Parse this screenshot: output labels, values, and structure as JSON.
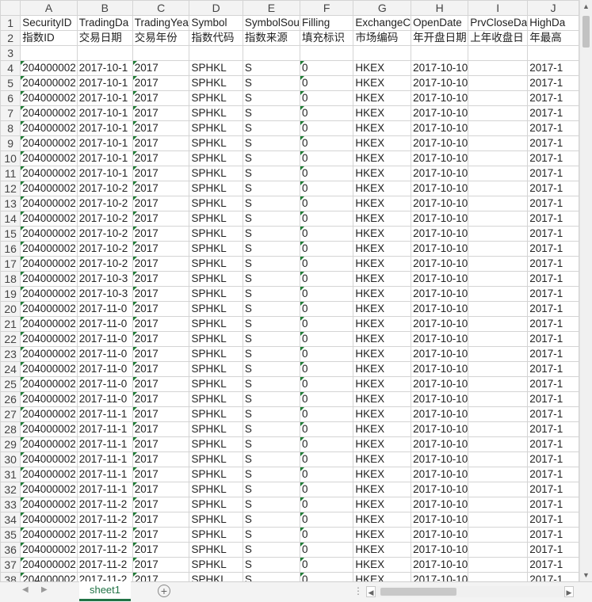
{
  "columns": [
    "A",
    "B",
    "C",
    "D",
    "E",
    "F",
    "G",
    "H",
    "I",
    "J"
  ],
  "header_row_en": [
    "SecurityID",
    "TradingDa",
    "TradingYea",
    "Symbol",
    "SymbolSou",
    "Filling",
    "ExchangeC",
    "OpenDate",
    "PrvCloseDa",
    "HighDa"
  ],
  "header_row_cn": [
    "指数ID",
    "交易日期",
    "交易年份",
    "指数代码",
    "指数来源",
    "填充标识",
    "市场编码",
    "年开盘日期",
    "上年收盘日",
    "年最高"
  ],
  "data_rows": [
    {
      "n": "4",
      "a": "204000002",
      "b": "2017-10-1",
      "c": "2017",
      "d": "SPHKL",
      "e": "S",
      "f": "0",
      "g": "HKEX",
      "h": "2017-10-10",
      "j": "2017-1"
    },
    {
      "n": "5",
      "a": "204000002",
      "b": "2017-10-1",
      "c": "2017",
      "d": "SPHKL",
      "e": "S",
      "f": "0",
      "g": "HKEX",
      "h": "2017-10-10",
      "j": "2017-1"
    },
    {
      "n": "6",
      "a": "204000002",
      "b": "2017-10-1",
      "c": "2017",
      "d": "SPHKL",
      "e": "S",
      "f": "0",
      "g": "HKEX",
      "h": "2017-10-10",
      "j": "2017-1"
    },
    {
      "n": "7",
      "a": "204000002",
      "b": "2017-10-1",
      "c": "2017",
      "d": "SPHKL",
      "e": "S",
      "f": "0",
      "g": "HKEX",
      "h": "2017-10-10",
      "j": "2017-1"
    },
    {
      "n": "8",
      "a": "204000002",
      "b": "2017-10-1",
      "c": "2017",
      "d": "SPHKL",
      "e": "S",
      "f": "0",
      "g": "HKEX",
      "h": "2017-10-10",
      "j": "2017-1"
    },
    {
      "n": "9",
      "a": "204000002",
      "b": "2017-10-1",
      "c": "2017",
      "d": "SPHKL",
      "e": "S",
      "f": "0",
      "g": "HKEX",
      "h": "2017-10-10",
      "j": "2017-1"
    },
    {
      "n": "10",
      "a": "204000002",
      "b": "2017-10-1",
      "c": "2017",
      "d": "SPHKL",
      "e": "S",
      "f": "0",
      "g": "HKEX",
      "h": "2017-10-10",
      "j": "2017-1"
    },
    {
      "n": "11",
      "a": "204000002",
      "b": "2017-10-1",
      "c": "2017",
      "d": "SPHKL",
      "e": "S",
      "f": "0",
      "g": "HKEX",
      "h": "2017-10-10",
      "j": "2017-1"
    },
    {
      "n": "12",
      "a": "204000002",
      "b": "2017-10-2",
      "c": "2017",
      "d": "SPHKL",
      "e": "S",
      "f": "0",
      "g": "HKEX",
      "h": "2017-10-10",
      "j": "2017-1"
    },
    {
      "n": "13",
      "a": "204000002",
      "b": "2017-10-2",
      "c": "2017",
      "d": "SPHKL",
      "e": "S",
      "f": "0",
      "g": "HKEX",
      "h": "2017-10-10",
      "j": "2017-1"
    },
    {
      "n": "14",
      "a": "204000002",
      "b": "2017-10-2",
      "c": "2017",
      "d": "SPHKL",
      "e": "S",
      "f": "0",
      "g": "HKEX",
      "h": "2017-10-10",
      "j": "2017-1"
    },
    {
      "n": "15",
      "a": "204000002",
      "b": "2017-10-2",
      "c": "2017",
      "d": "SPHKL",
      "e": "S",
      "f": "0",
      "g": "HKEX",
      "h": "2017-10-10",
      "j": "2017-1"
    },
    {
      "n": "16",
      "a": "204000002",
      "b": "2017-10-2",
      "c": "2017",
      "d": "SPHKL",
      "e": "S",
      "f": "0",
      "g": "HKEX",
      "h": "2017-10-10",
      "j": "2017-1"
    },
    {
      "n": "17",
      "a": "204000002",
      "b": "2017-10-2",
      "c": "2017",
      "d": "SPHKL",
      "e": "S",
      "f": "0",
      "g": "HKEX",
      "h": "2017-10-10",
      "j": "2017-1"
    },
    {
      "n": "18",
      "a": "204000002",
      "b": "2017-10-3",
      "c": "2017",
      "d": "SPHKL",
      "e": "S",
      "f": "0",
      "g": "HKEX",
      "h": "2017-10-10",
      "j": "2017-1"
    },
    {
      "n": "19",
      "a": "204000002",
      "b": "2017-10-3",
      "c": "2017",
      "d": "SPHKL",
      "e": "S",
      "f": "0",
      "g": "HKEX",
      "h": "2017-10-10",
      "j": "2017-1"
    },
    {
      "n": "20",
      "a": "204000002",
      "b": "2017-11-0",
      "c": "2017",
      "d": "SPHKL",
      "e": "S",
      "f": "0",
      "g": "HKEX",
      "h": "2017-10-10",
      "j": "2017-1"
    },
    {
      "n": "21",
      "a": "204000002",
      "b": "2017-11-0",
      "c": "2017",
      "d": "SPHKL",
      "e": "S",
      "f": "0",
      "g": "HKEX",
      "h": "2017-10-10",
      "j": "2017-1"
    },
    {
      "n": "22",
      "a": "204000002",
      "b": "2017-11-0",
      "c": "2017",
      "d": "SPHKL",
      "e": "S",
      "f": "0",
      "g": "HKEX",
      "h": "2017-10-10",
      "j": "2017-1"
    },
    {
      "n": "23",
      "a": "204000002",
      "b": "2017-11-0",
      "c": "2017",
      "d": "SPHKL",
      "e": "S",
      "f": "0",
      "g": "HKEX",
      "h": "2017-10-10",
      "j": "2017-1"
    },
    {
      "n": "24",
      "a": "204000002",
      "b": "2017-11-0",
      "c": "2017",
      "d": "SPHKL",
      "e": "S",
      "f": "0",
      "g": "HKEX",
      "h": "2017-10-10",
      "j": "2017-1"
    },
    {
      "n": "25",
      "a": "204000002",
      "b": "2017-11-0",
      "c": "2017",
      "d": "SPHKL",
      "e": "S",
      "f": "0",
      "g": "HKEX",
      "h": "2017-10-10",
      "j": "2017-1"
    },
    {
      "n": "26",
      "a": "204000002",
      "b": "2017-11-0",
      "c": "2017",
      "d": "SPHKL",
      "e": "S",
      "f": "0",
      "g": "HKEX",
      "h": "2017-10-10",
      "j": "2017-1"
    },
    {
      "n": "27",
      "a": "204000002",
      "b": "2017-11-1",
      "c": "2017",
      "d": "SPHKL",
      "e": "S",
      "f": "0",
      "g": "HKEX",
      "h": "2017-10-10",
      "j": "2017-1"
    },
    {
      "n": "28",
      "a": "204000002",
      "b": "2017-11-1",
      "c": "2017",
      "d": "SPHKL",
      "e": "S",
      "f": "0",
      "g": "HKEX",
      "h": "2017-10-10",
      "j": "2017-1"
    },
    {
      "n": "29",
      "a": "204000002",
      "b": "2017-11-1",
      "c": "2017",
      "d": "SPHKL",
      "e": "S",
      "f": "0",
      "g": "HKEX",
      "h": "2017-10-10",
      "j": "2017-1"
    },
    {
      "n": "30",
      "a": "204000002",
      "b": "2017-11-1",
      "c": "2017",
      "d": "SPHKL",
      "e": "S",
      "f": "0",
      "g": "HKEX",
      "h": "2017-10-10",
      "j": "2017-1"
    },
    {
      "n": "31",
      "a": "204000002",
      "b": "2017-11-1",
      "c": "2017",
      "d": "SPHKL",
      "e": "S",
      "f": "0",
      "g": "HKEX",
      "h": "2017-10-10",
      "j": "2017-1"
    },
    {
      "n": "32",
      "a": "204000002",
      "b": "2017-11-1",
      "c": "2017",
      "d": "SPHKL",
      "e": "S",
      "f": "0",
      "g": "HKEX",
      "h": "2017-10-10",
      "j": "2017-1"
    },
    {
      "n": "33",
      "a": "204000002",
      "b": "2017-11-2",
      "c": "2017",
      "d": "SPHKL",
      "e": "S",
      "f": "0",
      "g": "HKEX",
      "h": "2017-10-10",
      "j": "2017-1"
    },
    {
      "n": "34",
      "a": "204000002",
      "b": "2017-11-2",
      "c": "2017",
      "d": "SPHKL",
      "e": "S",
      "f": "0",
      "g": "HKEX",
      "h": "2017-10-10",
      "j": "2017-1"
    },
    {
      "n": "35",
      "a": "204000002",
      "b": "2017-11-2",
      "c": "2017",
      "d": "SPHKL",
      "e": "S",
      "f": "0",
      "g": "HKEX",
      "h": "2017-10-10",
      "j": "2017-1"
    },
    {
      "n": "36",
      "a": "204000002",
      "b": "2017-11-2",
      "c": "2017",
      "d": "SPHKL",
      "e": "S",
      "f": "0",
      "g": "HKEX",
      "h": "2017-10-10",
      "j": "2017-1"
    },
    {
      "n": "37",
      "a": "204000002",
      "b": "2017-11-2",
      "c": "2017",
      "d": "SPHKL",
      "e": "S",
      "f": "0",
      "g": "HKEX",
      "h": "2017-10-10",
      "j": "2017-1"
    },
    {
      "n": "38",
      "a": "204000002",
      "b": "2017-11-2",
      "c": "2017",
      "d": "SPHKL",
      "e": "S",
      "f": "0",
      "g": "HKEX",
      "h": "2017-10-10",
      "j": "2017-1"
    }
  ],
  "sheet_tab": "sheet1",
  "icons": {
    "add_sheet": "plus-circle-icon",
    "scroll_up": "arrow-up-icon",
    "scroll_down": "arrow-down-icon",
    "scroll_left": "arrow-left-icon",
    "scroll_right": "arrow-right-icon"
  },
  "colors": {
    "accent": "#217346",
    "error_triangle": "#1e7b34"
  }
}
